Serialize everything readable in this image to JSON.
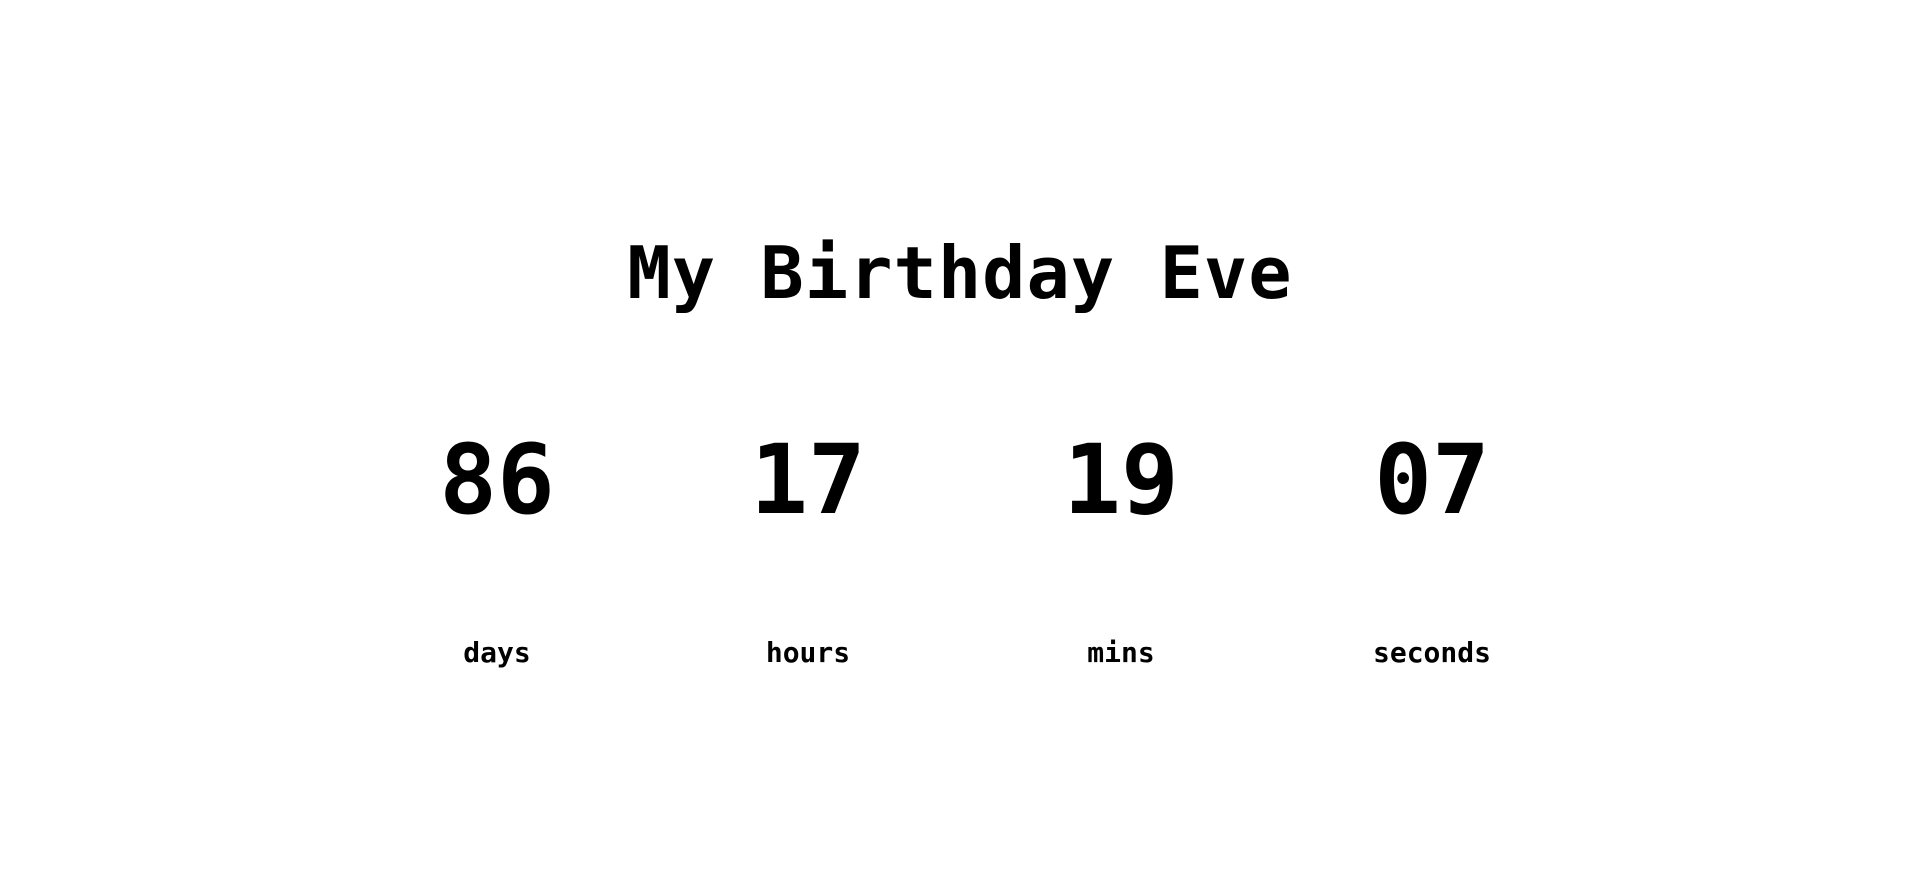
{
  "title": "My Birthday Eve",
  "countdown": [
    {
      "value": "86",
      "label": "days"
    },
    {
      "value": "17",
      "label": "hours"
    },
    {
      "value": "19",
      "label": "mins"
    },
    {
      "value": "07",
      "label": "seconds"
    }
  ],
  "colors": {
    "background": "#ffffff",
    "text": "#000000"
  }
}
